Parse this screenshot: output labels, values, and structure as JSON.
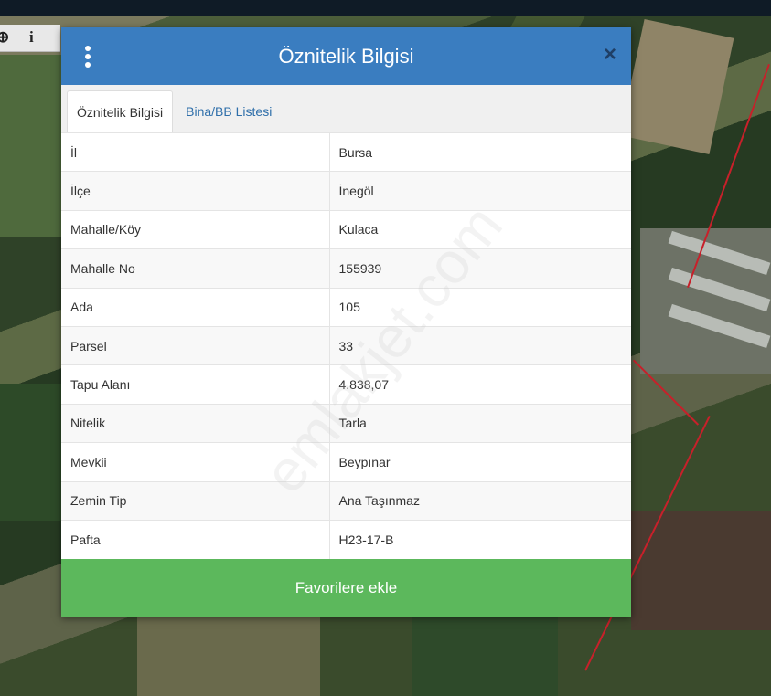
{
  "map": {
    "tools": [
      "⊕",
      "i"
    ]
  },
  "modal": {
    "title": "Öznitelik Bilgisi",
    "close_glyph": "×"
  },
  "tabs": [
    {
      "label": "Öznitelik Bilgisi",
      "active": true
    },
    {
      "label": "Bina/BB Listesi",
      "active": false
    }
  ],
  "attributes": [
    {
      "key": "İl",
      "value": "Bursa"
    },
    {
      "key": "İlçe",
      "value": "İnegöl"
    },
    {
      "key": "Mahalle/Köy",
      "value": "Kulaca"
    },
    {
      "key": "Mahalle No",
      "value": "155939"
    },
    {
      "key": "Ada",
      "value": "105"
    },
    {
      "key": "Parsel",
      "value": "33"
    },
    {
      "key": "Tapu Alanı",
      "value": "4.838,07"
    },
    {
      "key": "Nitelik",
      "value": "Tarla"
    },
    {
      "key": "Mevkii",
      "value": "Beypınar"
    },
    {
      "key": "Zemin Tip",
      "value": "Ana Taşınmaz"
    },
    {
      "key": "Pafta",
      "value": "H23-17-B"
    }
  ],
  "favorites_button": "Favorilere ekle",
  "watermark": "emlakjet.com",
  "colors": {
    "header": "#3a7dc0",
    "button": "#5cb85c",
    "parcel_border": "#c8202a"
  }
}
